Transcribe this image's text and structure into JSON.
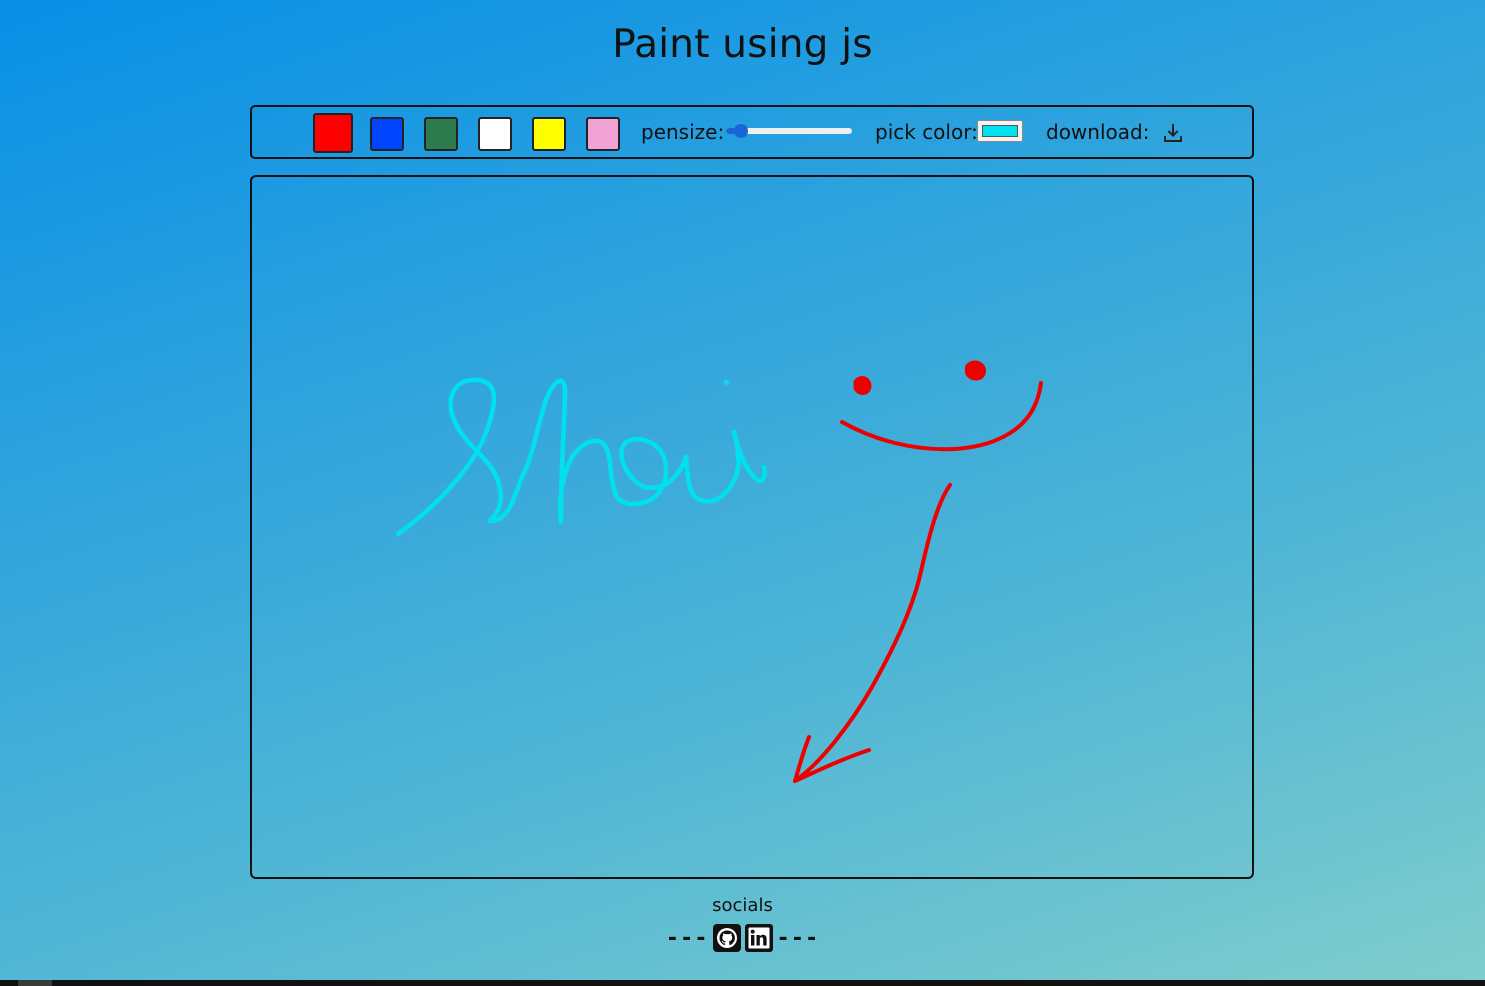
{
  "title": "Paint using js",
  "toolbar": {
    "swatches": [
      {
        "name": "red",
        "color": "#ff0000",
        "selected": true
      },
      {
        "name": "blue",
        "color": "#0044ff",
        "selected": false
      },
      {
        "name": "green",
        "color": "#2e7b4f",
        "selected": false
      },
      {
        "name": "white",
        "color": "#ffffff",
        "selected": false
      },
      {
        "name": "yellow",
        "color": "#ffff00",
        "selected": false
      },
      {
        "name": "pink",
        "color": "#f1a3d6",
        "selected": false
      }
    ],
    "pensize_label": "pensize:",
    "pensize_level": 0.12,
    "pick_color_label": "pick color:",
    "picked_color": "#00e1f0",
    "download_label": "download:",
    "download_icon": "download-icon"
  },
  "canvas": {
    "strokes": [
      {
        "name": "handwriting-text-stroke",
        "color": "#00e1f0"
      },
      {
        "name": "handwriting-dot-stroke",
        "color": "#00e1f0"
      },
      {
        "name": "smiley-eye-left-stroke",
        "color": "#ee0000"
      },
      {
        "name": "smiley-eye-right-stroke",
        "color": "#ee0000"
      },
      {
        "name": "smiley-mouth-stroke",
        "color": "#ee0000"
      },
      {
        "name": "arrow-shaft-stroke",
        "color": "#ee0000"
      },
      {
        "name": "arrow-head-stroke",
        "color": "#ee0000"
      }
    ]
  },
  "footer": {
    "socials_label": "socials",
    "dashes_left": "---",
    "dashes_right": "---",
    "icons": [
      "github-icon",
      "linkedin-icon"
    ]
  }
}
